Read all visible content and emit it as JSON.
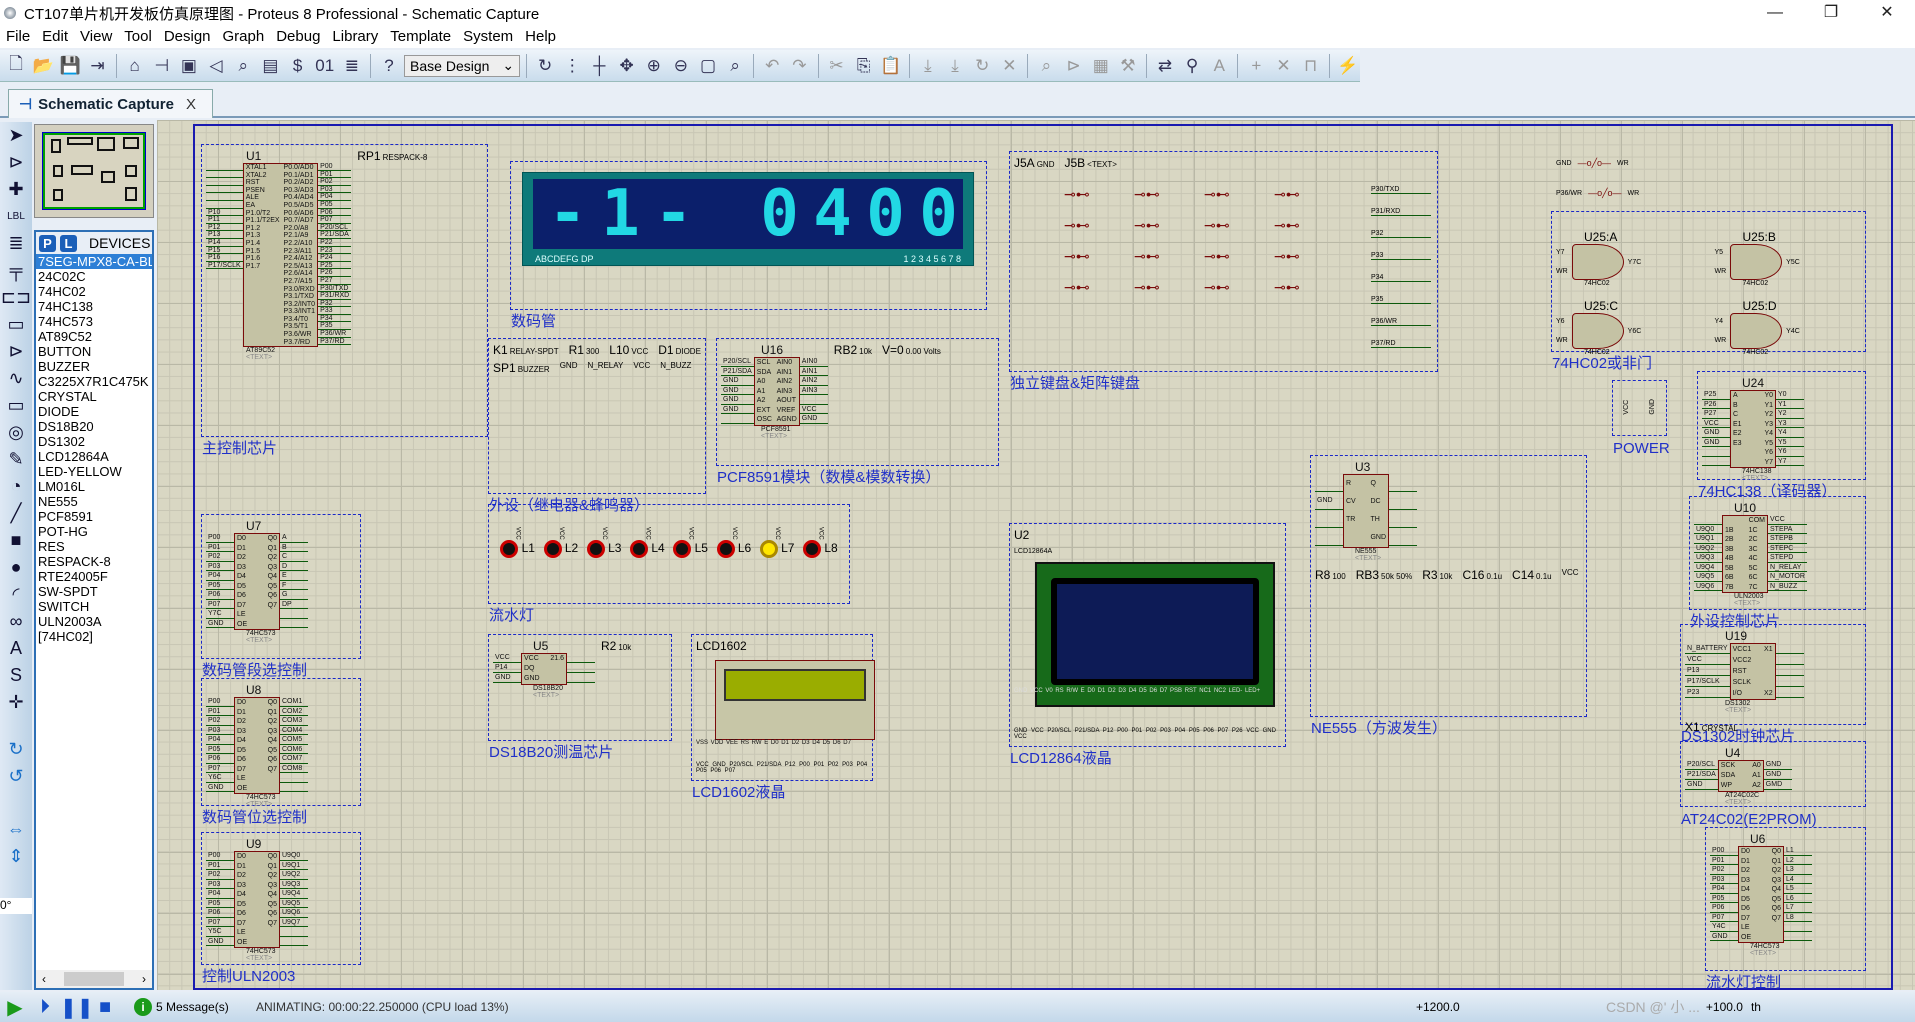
{
  "window": {
    "title": "CT107单片机开发板仿真原理图 - Proteus 8 Professional - Schematic Capture",
    "controls": [
      "—",
      "❐",
      "✕"
    ]
  },
  "menu": [
    "File",
    "Edit",
    "View",
    "Tool",
    "Design",
    "Graph",
    "Debug",
    "Library",
    "Template",
    "System",
    "Help"
  ],
  "toolbar": {
    "design_select": "Base Design",
    "icons": [
      "new-file",
      "open-folder",
      "save",
      "import",
      "home",
      "schematic",
      "pcb",
      "gerber",
      "3d-view",
      "bom",
      "dollar",
      "binary",
      "report",
      "help",
      "refresh",
      "grid",
      "origin",
      "pan",
      "zoom-in",
      "zoom-out",
      "zoom-fit",
      "zoom-area",
      "undo",
      "redo",
      "cut",
      "copy",
      "paste",
      "block-copy",
      "block-move",
      "block-rotate",
      "block-delete",
      "pick",
      "make-device",
      "package",
      "decompose",
      "wire-autorouter",
      "search",
      "property-assign",
      "new-sheet",
      "delete-sheet",
      "exit-to-parent",
      "netlist"
    ]
  },
  "tab": {
    "label": "Schematic Capture",
    "close": "X"
  },
  "left_tools": [
    "selection",
    "component",
    "junction",
    "wire-label",
    "text-script",
    "bus",
    "subcircuit",
    "terminal",
    "device-pin",
    "graph",
    "active-popup",
    "generator",
    "probe",
    "instrument",
    "line",
    "box",
    "circle",
    "arc",
    "path",
    "text",
    "symbol",
    "marker"
  ],
  "rotation": "0°",
  "devices": {
    "header": "DEVICES",
    "p": "P",
    "l": "L",
    "selected": "7SEG-MPX8-CA-BLUE",
    "items": [
      "7SEG-MPX8-CA-BL",
      "24C02C",
      "74HC02",
      "74HC138",
      "74HC573",
      "AT89C52",
      "BUTTON",
      "BUZZER",
      "C3225X7R1C475K",
      "CRYSTAL",
      "DIODE",
      "DS18B20",
      "DS1302",
      "LCD12864A",
      "LED-YELLOW",
      "LM016L",
      "NE555",
      "PCF8591",
      "POT-HG",
      "RES",
      "RESPACK-8",
      "RTE24005F",
      "SW-SPDT",
      "SWITCH",
      "ULN2003A",
      "[74HC02]"
    ]
  },
  "seven_seg": {
    "digits": [
      "-",
      "1",
      "-",
      " ",
      "0",
      "4",
      "0",
      "0"
    ],
    "seg_label": "ABCDEFG  DP",
    "digit_label": "1 2 3 4 5 6 7 8",
    "color": "#22d8e4"
  },
  "blocks": {
    "mcu": {
      "label": "主控制芯片",
      "chips": [
        {
          "ref": "U1",
          "part": "AT89C52",
          "text": "<TEXT>",
          "lnets": [
            "",
            "",
            "",
            "",
            "",
            "",
            "P10",
            "P11",
            "P12",
            "P13",
            "P14",
            "P15",
            "P16",
            "P17/SCLK"
          ],
          "left": [
            "XTAL1",
            "XTAL2",
            "RST",
            "PSEN",
            "ALE",
            "EA",
            "P1.0/T2",
            "P1.1/T2EX",
            "P1.2",
            "P1.3",
            "P1.4",
            "P1.5",
            "P1.6",
            "P1.7"
          ],
          "right": [
            "P0.0/AD0",
            "P0.1/AD1",
            "P0.2/AD2",
            "P0.3/AD3",
            "P0.4/AD4",
            "P0.5/AD5",
            "P0.6/AD6",
            "P0.7/AD7",
            "P2.0/A8",
            "P2.1/A9",
            "P2.2/A10",
            "P2.3/A11",
            "P2.4/A12",
            "P2.5/A13",
            "P2.6/A14",
            "P2.7/A15",
            "P3.0/RXD",
            "P3.1/TXD",
            "P3.2/INT0",
            "P3.3/INT1",
            "P3.4/T0",
            "P3.5/T1",
            "P3.6/WR",
            "P3.7/RD"
          ],
          "rnets": [
            "P00",
            "P01",
            "P02",
            "P03",
            "P04",
            "P05",
            "P06",
            "P07",
            "P20/SCL",
            "P21/SDA",
            "P22",
            "P23",
            "P24",
            "P25",
            "P26",
            "P27",
            "P30/TXD",
            "P31/RXD",
            "P32",
            "P33",
            "P34",
            "P35",
            "P36/WR",
            "P37/RD"
          ]
        }
      ],
      "parts": [
        {
          "ref": "RP1",
          "value": "RESPACK-8"
        }
      ]
    },
    "seg": {
      "label": "数码管",
      "chips": [],
      "parts": []
    },
    "periph": {
      "label": "外设（继电器&蜂鸣器）",
      "chips": [],
      "parts": [
        {
          "ref": "K1",
          "value": "RELAY-SPDT"
        },
        {
          "ref": "R1",
          "value": "300"
        },
        {
          "ref": "L10",
          "value": "VCC"
        },
        {
          "ref": "D1",
          "value": "DIODE"
        },
        {
          "ref": "SP1",
          "value": "BUZZER"
        },
        {
          "ref": "",
          "value": "GND"
        },
        {
          "ref": "",
          "value": "N_RELAY"
        },
        {
          "ref": "",
          "value": "VCC"
        },
        {
          "ref": "",
          "value": "N_BUZZ"
        }
      ]
    },
    "pcf": {
      "label": "PCF8591模块（数模&模数转换）",
      "chips": [
        {
          "ref": "U16",
          "part": "PCF8591",
          "text": "<TEXT>",
          "lnets": [
            "P20/SCL",
            "P21/SDA",
            "GND",
            "GND",
            "GND",
            "GND",
            ""
          ],
          "left": [
            "SCL",
            "SDA",
            "A0",
            "A1",
            "A2",
            "EXT",
            "OSC"
          ],
          "right": [
            "AIN0",
            "AIN1",
            "AIN2",
            "AIN3",
            "AOUT",
            "VREF",
            "AGND"
          ],
          "rnets": [
            "AIN0",
            "AIN1",
            "AIN2",
            "AIN3",
            "",
            "VCC",
            "GND"
          ]
        }
      ],
      "parts": [
        {
          "ref": "RB2",
          "value": "10k"
        },
        {
          "ref": "V=0",
          "value": "0.00 Volts"
        }
      ]
    },
    "keys": {
      "label": "独立键盘&矩阵键盘",
      "chips": [],
      "parts": [
        {
          "ref": "J5A",
          "value": "GND"
        },
        {
          "ref": "J5B",
          "value": "<TEXT>"
        }
      ],
      "nets": [
        "P30/TXD",
        "P31/RXD",
        "P32",
        "P33",
        "P34",
        "P35",
        "P36/WR",
        "P37/RD"
      ]
    },
    "nor": {
      "label": "74HC02或非门",
      "gates": [
        {
          "ref": "U25:A",
          "in": [
            "Y7",
            "WR"
          ],
          "out": "Y7C",
          "part": "74HC02"
        },
        {
          "ref": "U25:B",
          "in": [
            "Y5",
            "WR"
          ],
          "out": "Y5C",
          "part": "74HC02"
        },
        {
          "ref": "U25:C",
          "in": [
            "Y6",
            "WR"
          ],
          "out": "Y6C",
          "part": "74HC02"
        },
        {
          "ref": "U25:D",
          "in": [
            "Y4",
            "WR"
          ],
          "out": "Y4C",
          "part": "74HC02"
        }
      ]
    },
    "power": {
      "label": "POWER",
      "nets": [
        "VCC",
        "GND"
      ]
    },
    "hc138": {
      "label": "74HC138（译码器）",
      "chips": [
        {
          "ref": "U24",
          "part": "74HC138",
          "text": "<TEXT>",
          "lnets": [
            "P25",
            "P26",
            "P27",
            "VCC",
            "GND",
            "GND",
            "",
            ""
          ],
          "left": [
            "A",
            "B",
            "C",
            "E1",
            "E2",
            "E3",
            "",
            ""
          ],
          "right": [
            "Y0",
            "Y1",
            "Y2",
            "Y3",
            "Y4",
            "Y5",
            "Y6",
            "Y7"
          ],
          "rnets": [
            "Y0",
            "Y1",
            "Y2",
            "Y3",
            "Y4",
            "Y5",
            "Y6",
            "Y7"
          ]
        }
      ]
    },
    "u7": {
      "label": "数码管段选控制",
      "chips": [
        {
          "ref": "U7",
          "part": "74HC573",
          "text": "<TEXT>",
          "lnets": [
            "P00",
            "P01",
            "P02",
            "P03",
            "P04",
            "P05",
            "P06",
            "P07",
            "Y7C",
            "GND"
          ],
          "left": [
            "D0",
            "D1",
            "D2",
            "D3",
            "D4",
            "D5",
            "D6",
            "D7",
            "LE",
            "OE"
          ],
          "right": [
            "Q0",
            "Q1",
            "Q2",
            "Q3",
            "Q4",
            "Q5",
            "Q6",
            "Q7",
            "",
            ""
          ],
          "rnets": [
            "A",
            "B",
            "C",
            "D",
            "E",
            "F",
            "G",
            "DP",
            "",
            ""
          ]
        }
      ]
    },
    "u8": {
      "label": "数码管位选控制",
      "chips": [
        {
          "ref": "U8",
          "part": "74HC573",
          "text": "<TEXT>",
          "lnets": [
            "P00",
            "P01",
            "P02",
            "P03",
            "P04",
            "P05",
            "P06",
            "P07",
            "Y6C",
            "GND"
          ],
          "left": [
            "D0",
            "D1",
            "D2",
            "D3",
            "D4",
            "D5",
            "D6",
            "D7",
            "LE",
            "OE"
          ],
          "right": [
            "Q0",
            "Q1",
            "Q2",
            "Q3",
            "Q4",
            "Q5",
            "Q6",
            "Q7",
            "",
            ""
          ],
          "rnets": [
            "COM1",
            "COM2",
            "COM3",
            "COM4",
            "COM5",
            "COM6",
            "COM7",
            "COM8",
            "",
            ""
          ]
        }
      ]
    },
    "u9": {
      "label": "控制ULN2003",
      "chips": [
        {
          "ref": "U9",
          "part": "74HC573",
          "text": "<TEXT>",
          "lnets": [
            "P00",
            "P01",
            "P02",
            "P03",
            "P04",
            "P05",
            "P06",
            "P07",
            "Y5C",
            "GND"
          ],
          "left": [
            "D0",
            "D1",
            "D2",
            "D3",
            "D4",
            "D5",
            "D6",
            "D7",
            "LE",
            "OE"
          ],
          "right": [
            "Q0",
            "Q1",
            "Q2",
            "Q3",
            "Q4",
            "Q5",
            "Q6",
            "Q7",
            "",
            ""
          ],
          "rnets": [
            "U9Q0",
            "U9Q1",
            "U9Q2",
            "U9Q3",
            "U9Q4",
            "U9Q5",
            "U9Q6",
            "U9Q7",
            "",
            ""
          ]
        }
      ]
    },
    "leds": {
      "label": "流水灯",
      "leds": [
        {
          "ref": "L1",
          "on": false
        },
        {
          "ref": "L2",
          "on": false
        },
        {
          "ref": "L3",
          "on": false
        },
        {
          "ref": "L4",
          "on": false
        },
        {
          "ref": "L5",
          "on": false
        },
        {
          "ref": "L6",
          "on": false
        },
        {
          "ref": "L7",
          "on": true
        },
        {
          "ref": "L8",
          "on": false
        }
      ],
      "net": "VCC"
    },
    "ds18b20": {
      "label": "DS18B20测温芯片",
      "chips": [
        {
          "ref": "U5",
          "part": "DS18B20",
          "text": "<TEXT>",
          "lnets": [
            "VCC",
            "P14",
            "GND"
          ],
          "left": [
            "VCC",
            "DQ",
            "GND"
          ],
          "right": [
            "21.6",
            "",
            ""
          ],
          "rnets": [
            "",
            "",
            ""
          ]
        }
      ],
      "parts": [
        {
          "ref": "R2",
          "value": "10k"
        }
      ]
    },
    "lcd1602": {
      "label": "LCD1602液晶",
      "ref": "LCD1602",
      "text": "<TEXT>",
      "pins": "VSS VDD VEE RS RW E D0 D1 D2 D3 D4 D5 D6 D7",
      "nets": "VCC GND P20/SCL P21/SDA P12 P00 P01 P02 P03 P04 P05 P06 P07"
    },
    "lcd12864": {
      "label": "LCD12864液晶",
      "ref": "U2",
      "part": "LCD12864A",
      "pins": "GND VCC V0 RS R/W E D0 D1 D2 D3 D4 D5 D6 D7 PSB RST NC1 NC2 LED- LED+",
      "nets": "GND VCC P20/SCL P21/SDA P12 P00 P01 P02 P03 P04 P05 P06 P07 P26 VCC GND VCC"
    },
    "ne555": {
      "label": "NE555（方波发生）",
      "chips": [
        {
          "ref": "U3",
          "part": "NE555",
          "text": "<TEXT>",
          "lnets": [
            "",
            "GND",
            "",
            ""
          ],
          "left": [
            "R",
            "CV",
            "TR",
            ""
          ],
          "right": [
            "Q",
            "DC",
            "TH",
            "GND"
          ],
          "rnets": [
            "",
            "",
            "",
            ""
          ]
        }
      ],
      "parts": [
        {
          "ref": "R8",
          "value": "100"
        },
        {
          "ref": "RB3",
          "value": "50k 50%"
        },
        {
          "ref": "R3",
          "value": "10k"
        },
        {
          "ref": "C16",
          "value": "0.1u"
        },
        {
          "ref": "C14",
          "value": "0.1u"
        },
        {
          "ref": "",
          "value": "VCC"
        }
      ]
    },
    "uln": {
      "label": "外设控制芯片",
      "chips": [
        {
          "ref": "U10",
          "part": "ULN2003",
          "text": "<TEXT>",
          "lnets": [
            "",
            "U9Q0",
            "U9Q1",
            "U9Q2",
            "U9Q3",
            "U9Q4",
            "U9Q5",
            "U9Q6"
          ],
          "left": [
            "",
            "1B",
            "2B",
            "3B",
            "4B",
            "5B",
            "6B",
            "7B"
          ],
          "right": [
            "COM",
            "1C",
            "2C",
            "3C",
            "4C",
            "5C",
            "6C",
            "7C"
          ],
          "rnets": [
            "VCC",
            "STEPA",
            "STEPB",
            "STEPC",
            "STEPD",
            "N_RELAY",
            "N_MOTOR",
            "N_BUZZ"
          ]
        }
      ]
    },
    "ds1302": {
      "label": "DS1302时钟芯片",
      "chips": [
        {
          "ref": "U19",
          "part": "DS1302",
          "text": "<TEXT>",
          "lnets": [
            "N_BATTERY",
            "VCC",
            "P13",
            "P17/SCLK",
            "P23"
          ],
          "left": [
            "VCC1",
            "VCC2",
            "RST",
            "SCLK",
            "I/O"
          ],
          "right": [
            "X1",
            "",
            "",
            "",
            "X2"
          ],
          "rnets": [
            "",
            "",
            "",
            "",
            ""
          ]
        }
      ],
      "parts": [
        {
          "ref": "X1",
          "value": "CRYSTAL"
        }
      ]
    },
    "at24": {
      "label": "AT24C02(E2PROM)",
      "chips": [
        {
          "ref": "U4",
          "part": "AT24C02C",
          "text": "<TEXT>",
          "lnets": [
            "P20/SCL",
            "P21/SDA",
            "GND"
          ],
          "left": [
            "SCK",
            "SDA",
            "WP"
          ],
          "right": [
            "A0",
            "A1",
            "A2"
          ],
          "rnets": [
            "GND",
            "GND",
            "GMD"
          ]
        }
      ]
    },
    "u6": {
      "label": "流水灯控制",
      "chips": [
        {
          "ref": "U6",
          "part": "74HC573",
          "text": "<TEXT>",
          "lnets": [
            "P00",
            "P01",
            "P02",
            "P03",
            "P04",
            "P05",
            "P06",
            "P07",
            "Y4C",
            "GND"
          ],
          "left": [
            "D0",
            "D1",
            "D2",
            "D3",
            "D4",
            "D5",
            "D6",
            "D7",
            "LE",
            "OE"
          ],
          "right": [
            "Q0",
            "Q1",
            "Q2",
            "Q3",
            "Q4",
            "Q5",
            "Q6",
            "Q7",
            "",
            ""
          ],
          "rnets": [
            "L1",
            "L2",
            "L3",
            "L4",
            "L5",
            "L6",
            "L7",
            "L8",
            "",
            ""
          ]
        }
      ]
    }
  },
  "top_switches": [
    {
      "from": "GND",
      "to": "WR"
    },
    {
      "from": "P36/WR",
      "to": "WR"
    }
  ],
  "status": {
    "messages": "5 Message(s)",
    "animating": "ANIMATING: 00:00:22.250000 (CPU load 13%)",
    "x": "+1200.0",
    "y": "+100.0",
    "unit": "th",
    "watermark": "CSDN @' 小 ..."
  }
}
